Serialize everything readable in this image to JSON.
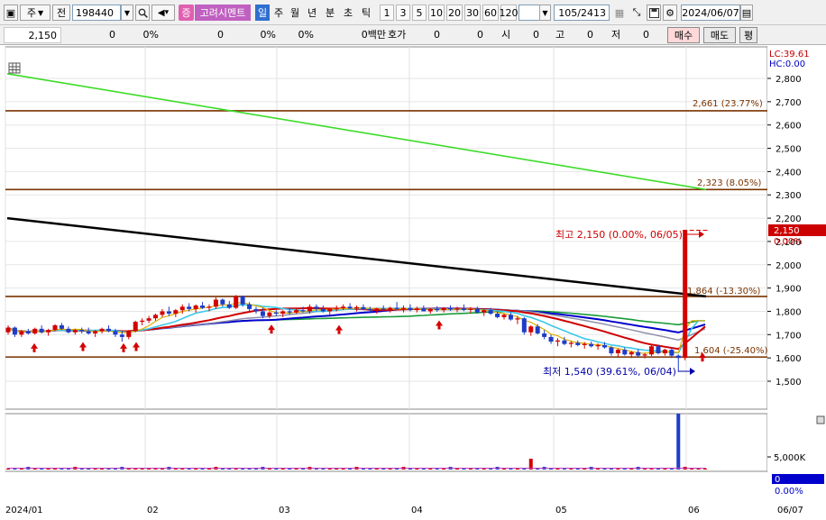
{
  "toolbar": {
    "code_type": "주",
    "market_label": "전",
    "code_value": "198440",
    "badge_jung": "증",
    "stock_name": "고려시멘트",
    "periods": [
      "일",
      "주",
      "월",
      "년",
      "분",
      "초",
      "틱"
    ],
    "active_period": "일",
    "numbers": [
      "1",
      "3",
      "5",
      "10",
      "20",
      "30",
      "60",
      "120"
    ],
    "count_display": "105/2413",
    "date_value": "2024/06/07"
  },
  "quote": {
    "price": "2,150",
    "change": "0",
    "change_pct": "0%",
    "volume": "0",
    "volume_pct": "0%",
    "extra_pct": "0%",
    "amount_label": "0백만",
    "hoga_label": "호가",
    "hoga_val1": "0",
    "hoga_val2": "0",
    "open_label": "시",
    "open_val": "0",
    "high_label": "고",
    "high_val": "0",
    "low_label": "저",
    "low_val": "0",
    "buy_label": "매수",
    "sell_label": "매도",
    "eval_label": "평"
  },
  "chart_data": {
    "type": "candlestick",
    "x_ticks": [
      "2024/01",
      "02",
      "03",
      "04",
      "05",
      "06",
      "06/07"
    ],
    "price_axis": {
      "ticks": [
        2800,
        2700,
        2600,
        2500,
        2400,
        2300,
        2200,
        2100,
        2000,
        1900,
        1800,
        1700,
        1600,
        1500
      ],
      "tick_labels": [
        "2,800",
        "2,700",
        "2,600",
        "2,500",
        "2,400",
        "2,300",
        "2,200",
        "2,100",
        "2,000",
        "1,900",
        "1,800",
        "1,700",
        "1,600",
        "1,500"
      ],
      "range": [
        1480,
        2880
      ]
    },
    "corner_info": [
      "LC:39.61",
      "HC:0.00"
    ],
    "current_price": {
      "label": "2,150",
      "value": 2150,
      "pct_label": "0.00%"
    },
    "levels": [
      {
        "value": 2661,
        "label": "2,661 (23.77%)"
      },
      {
        "value": 2323,
        "label": "2,323 (8.05%)"
      },
      {
        "value": 1864,
        "label": "1,864 (-13.30%)"
      },
      {
        "value": 1604,
        "label": "1,604 (-25.40%)"
      }
    ],
    "annotations": {
      "high": {
        "value": 2150,
        "label": "최고 2,150 (0.00%, 06/05)"
      },
      "low": {
        "value": 1540,
        "label": "최저 1,540 (39.61%, 06/04)"
      }
    },
    "candles": [
      [
        1710,
        1740,
        1700,
        1730
      ],
      [
        1730,
        1735,
        1690,
        1700
      ],
      [
        1700,
        1720,
        1690,
        1715
      ],
      [
        1715,
        1725,
        1700,
        1705
      ],
      [
        1705,
        1730,
        1700,
        1725
      ],
      [
        1725,
        1740,
        1705,
        1710
      ],
      [
        1710,
        1725,
        1695,
        1720
      ],
      [
        1720,
        1745,
        1715,
        1740
      ],
      [
        1740,
        1750,
        1720,
        1725
      ],
      [
        1725,
        1735,
        1705,
        1710
      ],
      [
        1710,
        1725,
        1700,
        1720
      ],
      [
        1720,
        1730,
        1705,
        1715
      ],
      [
        1715,
        1730,
        1700,
        1705
      ],
      [
        1705,
        1720,
        1690,
        1715
      ],
      [
        1715,
        1730,
        1705,
        1725
      ],
      [
        1725,
        1740,
        1710,
        1715
      ],
      [
        1715,
        1725,
        1690,
        1700
      ],
      [
        1700,
        1715,
        1670,
        1690
      ],
      [
        1690,
        1720,
        1680,
        1715
      ],
      [
        1715,
        1760,
        1710,
        1755
      ],
      [
        1755,
        1770,
        1740,
        1760
      ],
      [
        1760,
        1780,
        1750,
        1770
      ],
      [
        1770,
        1790,
        1760,
        1785
      ],
      [
        1785,
        1810,
        1775,
        1800
      ],
      [
        1800,
        1820,
        1780,
        1790
      ],
      [
        1790,
        1810,
        1775,
        1805
      ],
      [
        1805,
        1830,
        1790,
        1820
      ],
      [
        1820,
        1835,
        1800,
        1810
      ],
      [
        1810,
        1830,
        1795,
        1825
      ],
      [
        1825,
        1840,
        1810,
        1815
      ],
      [
        1815,
        1830,
        1800,
        1820
      ],
      [
        1820,
        1860,
        1810,
        1850
      ],
      [
        1850,
        1855,
        1820,
        1830
      ],
      [
        1830,
        1845,
        1810,
        1815
      ],
      [
        1815,
        1870,
        1810,
        1865
      ],
      [
        1865,
        1868,
        1820,
        1830
      ],
      [
        1830,
        1840,
        1800,
        1810
      ],
      [
        1810,
        1820,
        1790,
        1800
      ],
      [
        1800,
        1815,
        1770,
        1780
      ],
      [
        1780,
        1800,
        1770,
        1795
      ],
      [
        1795,
        1805,
        1780,
        1790
      ],
      [
        1790,
        1805,
        1775,
        1800
      ],
      [
        1800,
        1815,
        1785,
        1795
      ],
      [
        1795,
        1810,
        1790,
        1805
      ],
      [
        1805,
        1820,
        1795,
        1800
      ],
      [
        1800,
        1830,
        1790,
        1820
      ],
      [
        1820,
        1830,
        1800,
        1810
      ],
      [
        1810,
        1825,
        1795,
        1800
      ],
      [
        1800,
        1815,
        1785,
        1810
      ],
      [
        1810,
        1825,
        1800,
        1815
      ],
      [
        1815,
        1830,
        1805,
        1820
      ],
      [
        1820,
        1835,
        1810,
        1812
      ],
      [
        1812,
        1825,
        1800,
        1818
      ],
      [
        1818,
        1830,
        1805,
        1810
      ],
      [
        1810,
        1820,
        1795,
        1805
      ],
      [
        1805,
        1815,
        1790,
        1812
      ],
      [
        1812,
        1825,
        1800,
        1808
      ],
      [
        1808,
        1820,
        1795,
        1815
      ],
      [
        1815,
        1840,
        1805,
        1810
      ],
      [
        1810,
        1825,
        1795,
        1815
      ],
      [
        1815,
        1830,
        1800,
        1805
      ],
      [
        1805,
        1820,
        1795,
        1812
      ],
      [
        1812,
        1825,
        1800,
        1800
      ],
      [
        1800,
        1815,
        1790,
        1810
      ],
      [
        1810,
        1822,
        1798,
        1805
      ],
      [
        1805,
        1818,
        1795,
        1815
      ],
      [
        1815,
        1826,
        1802,
        1808
      ],
      [
        1808,
        1820,
        1796,
        1812
      ],
      [
        1812,
        1830,
        1800,
        1806
      ],
      [
        1806,
        1818,
        1792,
        1810
      ],
      [
        1810,
        1820,
        1790,
        1795
      ],
      [
        1795,
        1810,
        1780,
        1805
      ],
      [
        1805,
        1815,
        1785,
        1790
      ],
      [
        1790,
        1800,
        1770,
        1775
      ],
      [
        1775,
        1790,
        1765,
        1785
      ],
      [
        1785,
        1795,
        1760,
        1765
      ],
      [
        1765,
        1780,
        1745,
        1770
      ],
      [
        1770,
        1775,
        1700,
        1710
      ],
      [
        1710,
        1740,
        1695,
        1735
      ],
      [
        1735,
        1745,
        1700,
        1705
      ],
      [
        1705,
        1720,
        1680,
        1690
      ],
      [
        1690,
        1700,
        1660,
        1670
      ],
      [
        1670,
        1685,
        1650,
        1675
      ],
      [
        1675,
        1690,
        1655,
        1660
      ],
      [
        1660,
        1672,
        1645,
        1665
      ],
      [
        1665,
        1675,
        1650,
        1655
      ],
      [
        1655,
        1668,
        1640,
        1660
      ],
      [
        1660,
        1670,
        1645,
        1650
      ],
      [
        1650,
        1662,
        1635,
        1655
      ],
      [
        1655,
        1668,
        1640,
        1645
      ],
      [
        1645,
        1650,
        1610,
        1620
      ],
      [
        1620,
        1640,
        1605,
        1635
      ],
      [
        1635,
        1645,
        1610,
        1615
      ],
      [
        1615,
        1630,
        1600,
        1625
      ],
      [
        1625,
        1638,
        1605,
        1610
      ],
      [
        1610,
        1622,
        1598,
        1615
      ],
      [
        1615,
        1660,
        1608,
        1650
      ],
      [
        1650,
        1655,
        1615,
        1620
      ],
      [
        1620,
        1640,
        1610,
        1635
      ],
      [
        1635,
        1645,
        1600,
        1610
      ],
      [
        1610,
        1615,
        1540,
        1600
      ],
      [
        1600,
        2150,
        1590,
        2150
      ],
      [
        2150,
        2150,
        2150,
        2150
      ],
      [
        2150,
        2150,
        2150,
        2150
      ],
      [
        2150,
        2150,
        2150,
        2150
      ]
    ],
    "volume_axis": {
      "tick_labels": [
        "5,000K"
      ],
      "right_badge": "0",
      "right_pct": "0.00%"
    }
  }
}
